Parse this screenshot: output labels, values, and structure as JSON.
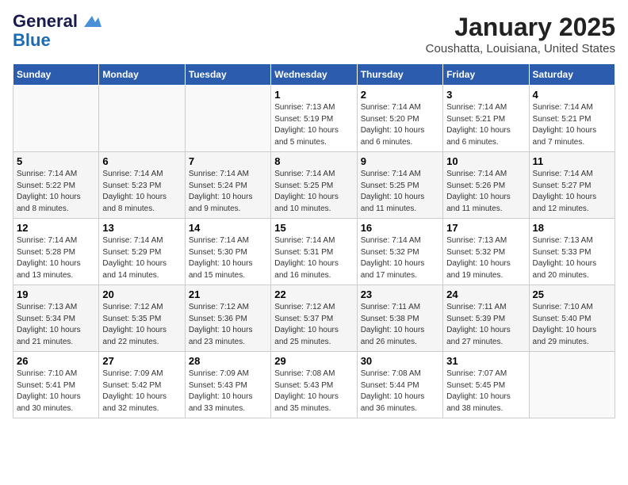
{
  "logo": {
    "line1": "General",
    "line2": "Blue",
    "bird_unicode": "▲"
  },
  "title": "January 2025",
  "subtitle": "Coushatta, Louisiana, United States",
  "days_of_week": [
    "Sunday",
    "Monday",
    "Tuesday",
    "Wednesday",
    "Thursday",
    "Friday",
    "Saturday"
  ],
  "weeks": [
    [
      {
        "day": "",
        "info": ""
      },
      {
        "day": "",
        "info": ""
      },
      {
        "day": "",
        "info": ""
      },
      {
        "day": "1",
        "info": "Sunrise: 7:13 AM\nSunset: 5:19 PM\nDaylight: 10 hours\nand 5 minutes."
      },
      {
        "day": "2",
        "info": "Sunrise: 7:14 AM\nSunset: 5:20 PM\nDaylight: 10 hours\nand 6 minutes."
      },
      {
        "day": "3",
        "info": "Sunrise: 7:14 AM\nSunset: 5:21 PM\nDaylight: 10 hours\nand 6 minutes."
      },
      {
        "day": "4",
        "info": "Sunrise: 7:14 AM\nSunset: 5:21 PM\nDaylight: 10 hours\nand 7 minutes."
      }
    ],
    [
      {
        "day": "5",
        "info": "Sunrise: 7:14 AM\nSunset: 5:22 PM\nDaylight: 10 hours\nand 8 minutes."
      },
      {
        "day": "6",
        "info": "Sunrise: 7:14 AM\nSunset: 5:23 PM\nDaylight: 10 hours\nand 8 minutes."
      },
      {
        "day": "7",
        "info": "Sunrise: 7:14 AM\nSunset: 5:24 PM\nDaylight: 10 hours\nand 9 minutes."
      },
      {
        "day": "8",
        "info": "Sunrise: 7:14 AM\nSunset: 5:25 PM\nDaylight: 10 hours\nand 10 minutes."
      },
      {
        "day": "9",
        "info": "Sunrise: 7:14 AM\nSunset: 5:25 PM\nDaylight: 10 hours\nand 11 minutes."
      },
      {
        "day": "10",
        "info": "Sunrise: 7:14 AM\nSunset: 5:26 PM\nDaylight: 10 hours\nand 11 minutes."
      },
      {
        "day": "11",
        "info": "Sunrise: 7:14 AM\nSunset: 5:27 PM\nDaylight: 10 hours\nand 12 minutes."
      }
    ],
    [
      {
        "day": "12",
        "info": "Sunrise: 7:14 AM\nSunset: 5:28 PM\nDaylight: 10 hours\nand 13 minutes."
      },
      {
        "day": "13",
        "info": "Sunrise: 7:14 AM\nSunset: 5:29 PM\nDaylight: 10 hours\nand 14 minutes."
      },
      {
        "day": "14",
        "info": "Sunrise: 7:14 AM\nSunset: 5:30 PM\nDaylight: 10 hours\nand 15 minutes."
      },
      {
        "day": "15",
        "info": "Sunrise: 7:14 AM\nSunset: 5:31 PM\nDaylight: 10 hours\nand 16 minutes."
      },
      {
        "day": "16",
        "info": "Sunrise: 7:14 AM\nSunset: 5:32 PM\nDaylight: 10 hours\nand 17 minutes."
      },
      {
        "day": "17",
        "info": "Sunrise: 7:13 AM\nSunset: 5:32 PM\nDaylight: 10 hours\nand 19 minutes."
      },
      {
        "day": "18",
        "info": "Sunrise: 7:13 AM\nSunset: 5:33 PM\nDaylight: 10 hours\nand 20 minutes."
      }
    ],
    [
      {
        "day": "19",
        "info": "Sunrise: 7:13 AM\nSunset: 5:34 PM\nDaylight: 10 hours\nand 21 minutes."
      },
      {
        "day": "20",
        "info": "Sunrise: 7:12 AM\nSunset: 5:35 PM\nDaylight: 10 hours\nand 22 minutes."
      },
      {
        "day": "21",
        "info": "Sunrise: 7:12 AM\nSunset: 5:36 PM\nDaylight: 10 hours\nand 23 minutes."
      },
      {
        "day": "22",
        "info": "Sunrise: 7:12 AM\nSunset: 5:37 PM\nDaylight: 10 hours\nand 25 minutes."
      },
      {
        "day": "23",
        "info": "Sunrise: 7:11 AM\nSunset: 5:38 PM\nDaylight: 10 hours\nand 26 minutes."
      },
      {
        "day": "24",
        "info": "Sunrise: 7:11 AM\nSunset: 5:39 PM\nDaylight: 10 hours\nand 27 minutes."
      },
      {
        "day": "25",
        "info": "Sunrise: 7:10 AM\nSunset: 5:40 PM\nDaylight: 10 hours\nand 29 minutes."
      }
    ],
    [
      {
        "day": "26",
        "info": "Sunrise: 7:10 AM\nSunset: 5:41 PM\nDaylight: 10 hours\nand 30 minutes."
      },
      {
        "day": "27",
        "info": "Sunrise: 7:09 AM\nSunset: 5:42 PM\nDaylight: 10 hours\nand 32 minutes."
      },
      {
        "day": "28",
        "info": "Sunrise: 7:09 AM\nSunset: 5:43 PM\nDaylight: 10 hours\nand 33 minutes."
      },
      {
        "day": "29",
        "info": "Sunrise: 7:08 AM\nSunset: 5:43 PM\nDaylight: 10 hours\nand 35 minutes."
      },
      {
        "day": "30",
        "info": "Sunrise: 7:08 AM\nSunset: 5:44 PM\nDaylight: 10 hours\nand 36 minutes."
      },
      {
        "day": "31",
        "info": "Sunrise: 7:07 AM\nSunset: 5:45 PM\nDaylight: 10 hours\nand 38 minutes."
      },
      {
        "day": "",
        "info": ""
      }
    ]
  ]
}
